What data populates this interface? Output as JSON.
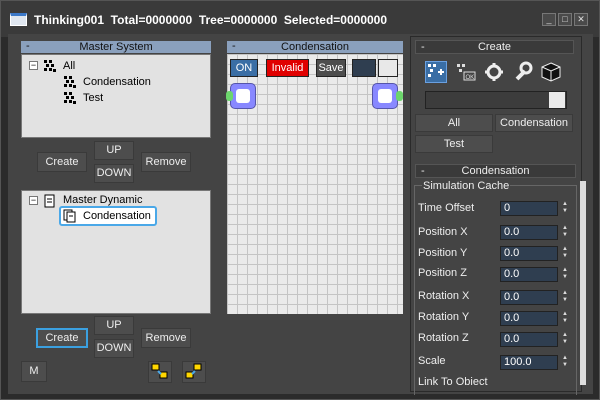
{
  "window": {
    "title": "Thinking001  Total=0000000  Tree=0000000  Selected=0000000",
    "controls": [
      "_",
      "□",
      "✕"
    ]
  },
  "master_system": {
    "header": "Master System",
    "tree": [
      {
        "label": "All",
        "expander": "−",
        "icon": "particle-group-icon"
      },
      {
        "label": "Condensation",
        "icon": "particle-group-icon"
      },
      {
        "label": "Test",
        "icon": "particle-group-icon"
      }
    ],
    "buttons": {
      "create": "Create",
      "up": "UP",
      "down": "DOWN",
      "remove": "Remove"
    }
  },
  "master_dynamic": {
    "tree": [
      {
        "label": "Master Dynamic",
        "expander": "−",
        "icon": "document-icon"
      },
      {
        "label": "Condensation",
        "icon": "document-stack-icon",
        "selected": true
      }
    ],
    "buttons": {
      "create": "Create",
      "up": "UP",
      "down": "DOWN",
      "remove": "Remove",
      "m": "M"
    }
  },
  "condensation_editor": {
    "header": "Condensation",
    "on_label": "ON",
    "invalid_label": "Invalid",
    "save_label": "Save"
  },
  "create_rollout": {
    "header": "Create",
    "filter_all": "All",
    "filter_condensation": "Condensation",
    "filter_test": "Test",
    "tools": [
      "add-node-icon",
      "ok-node-icon",
      "gear-icon",
      "wrench-icon",
      "cube-icon"
    ]
  },
  "condensation_rollout": {
    "header": "Condensation",
    "section": "Simulation Cache",
    "properties": [
      {
        "label": "Time Offset",
        "value": "0"
      },
      {
        "label": "Position X",
        "value": "0.0"
      },
      {
        "label": "Position Y",
        "value": "0.0"
      },
      {
        "label": "Position Z",
        "value": "0.0"
      },
      {
        "label": "Rotation X",
        "value": "0.0"
      },
      {
        "label": "Rotation Y",
        "value": "0.0"
      },
      {
        "label": "Rotation Z",
        "value": "0.0"
      },
      {
        "label": "Scale",
        "value": "100.0"
      }
    ],
    "link_label": "Link To Object"
  },
  "colors": {
    "accent": "#3ba0e0",
    "invalid": "#e00000",
    "node": "#8888ff",
    "port": "#6cd66c",
    "panel_header": "#8aa0bd"
  }
}
